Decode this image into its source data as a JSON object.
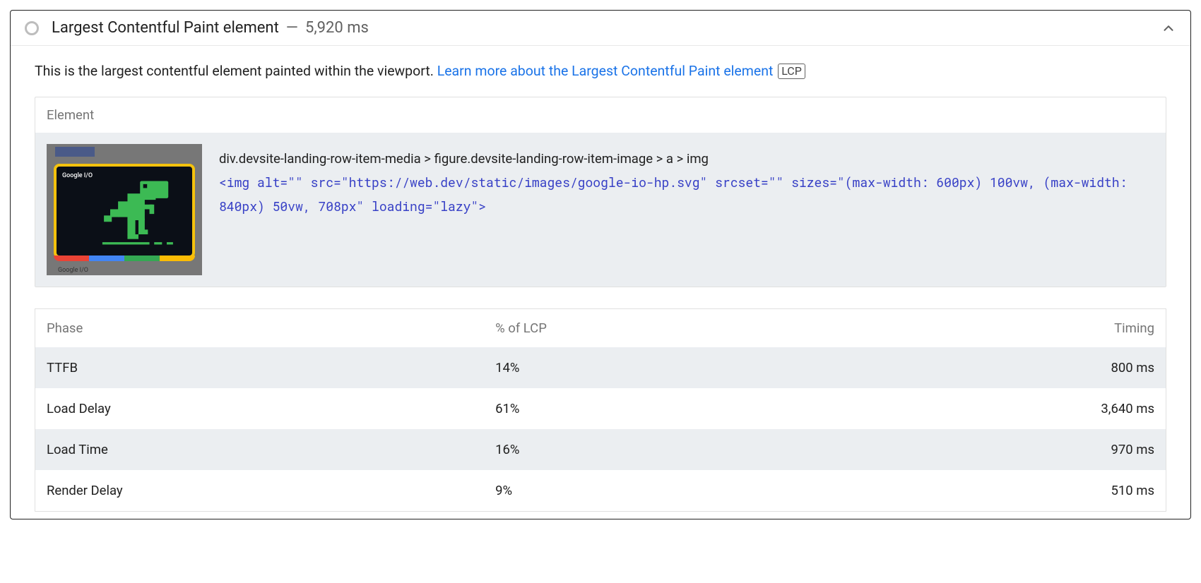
{
  "header": {
    "title": "Largest Contentful Paint element",
    "separator": "—",
    "metric": "5,920 ms"
  },
  "description": {
    "intro": "This is the largest contentful element painted within the viewport. ",
    "link_text": "Learn more about the Largest Contentful Paint element",
    "badge": "LCP"
  },
  "element_card": {
    "heading": "Element",
    "thumb_label": "Google I/O",
    "thumb_caption": "Google I/O",
    "selector_path": "div.devsite-landing-row-item-media > figure.devsite-landing-row-item-image > a > img",
    "snippet": "<img alt=\"\" src=\"https://web.dev/static/images/google-io-hp.svg\" srcset=\"\" sizes=\"(max-width: 600px) 100vw, (max-width: 840px) 50vw, 708px\" loading=\"lazy\">"
  },
  "phase_table": {
    "columns": {
      "phase": "Phase",
      "pct": "% of LCP",
      "timing": "Timing"
    },
    "rows": [
      {
        "phase": "TTFB",
        "pct": "14%",
        "timing": "800 ms"
      },
      {
        "phase": "Load Delay",
        "pct": "61%",
        "timing": "3,640 ms"
      },
      {
        "phase": "Load Time",
        "pct": "16%",
        "timing": "970 ms"
      },
      {
        "phase": "Render Delay",
        "pct": "9%",
        "timing": "510 ms"
      }
    ]
  }
}
